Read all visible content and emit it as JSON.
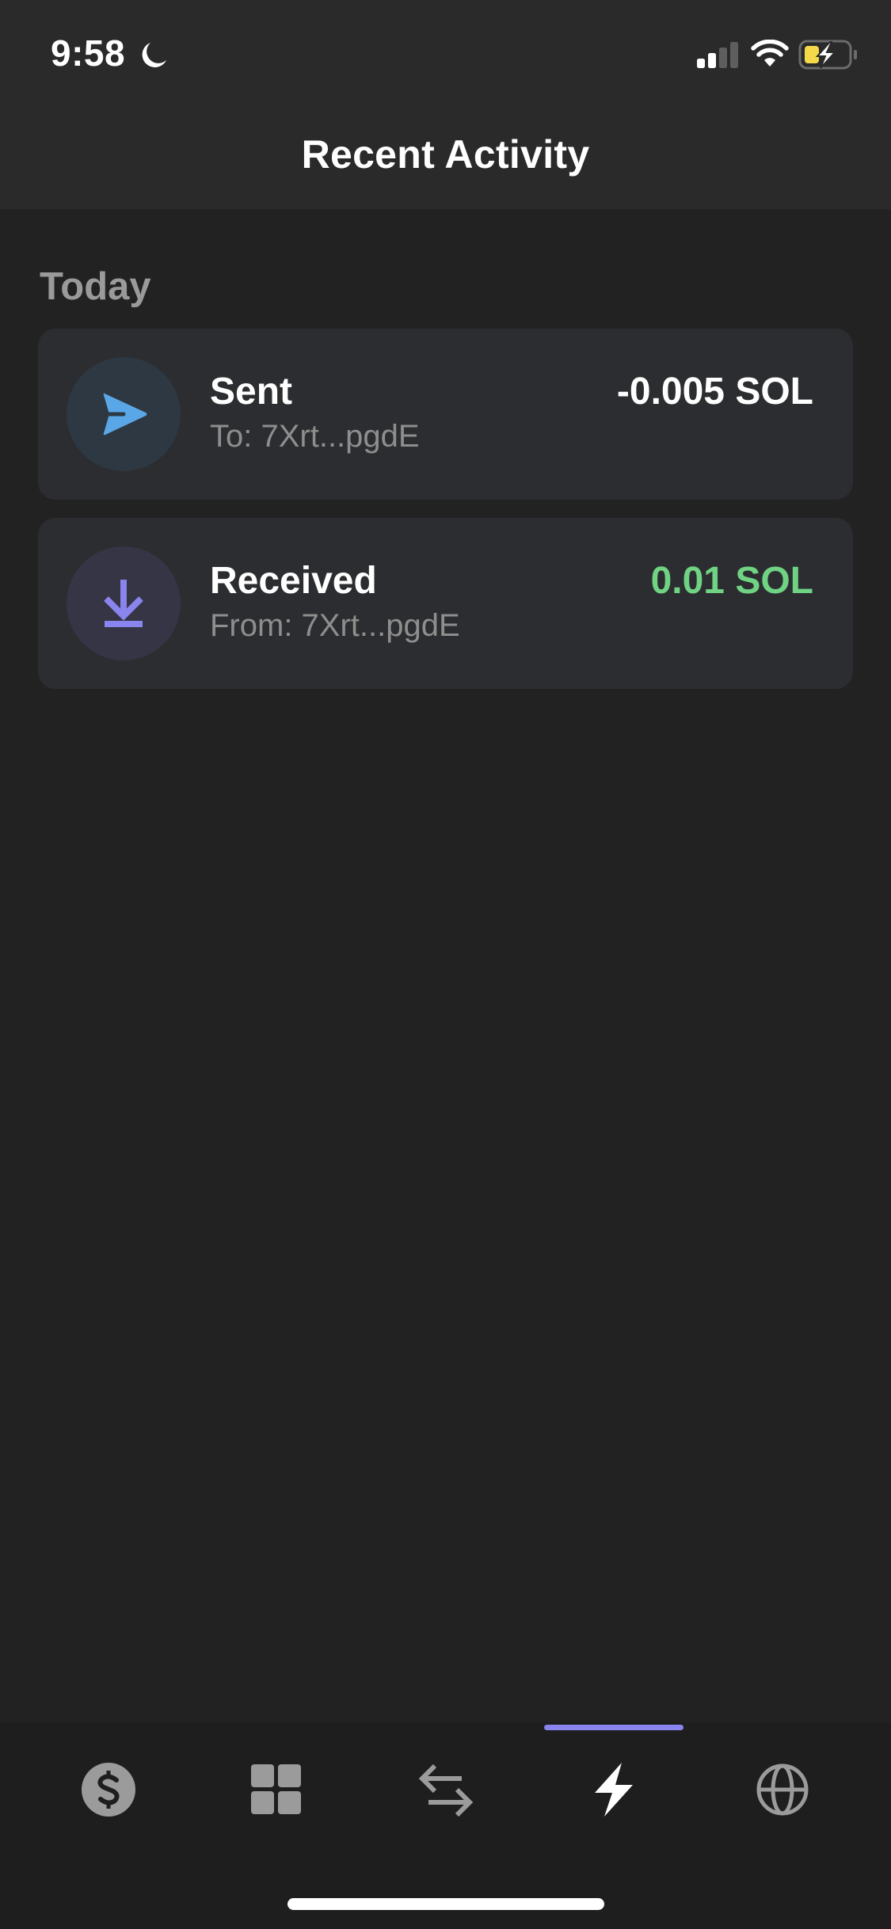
{
  "status_bar": {
    "time": "9:58",
    "focus_mode_icon": "moon-icon",
    "signal_bars_filled": 2,
    "signal_bars_total": 4,
    "wifi_icon": "wifi-icon",
    "battery_icon": "battery-charging-icon",
    "battery_state": "low-power-charging"
  },
  "header": {
    "title": "Recent Activity"
  },
  "sections": [
    {
      "label": "Today",
      "transactions": [
        {
          "type": "Sent",
          "icon": "send-icon",
          "counterparty_label": "To: 7Xrt...pgdE",
          "amount": "-0.005 SOL",
          "amount_color": "#ffffff",
          "icon_color": "#5aa7e8"
        },
        {
          "type": "Received",
          "icon": "download-icon",
          "counterparty_label": "From: 7Xrt...pgdE",
          "amount": "0.01 SOL",
          "amount_color": "#6fd383",
          "icon_color": "#8a84ee"
        }
      ]
    }
  ],
  "tab_bar": {
    "active_index": 3,
    "accent_color": "#8a84ee",
    "tabs": [
      {
        "name": "wallet",
        "icon": "dollar-circle-icon"
      },
      {
        "name": "collectibles",
        "icon": "grid-icon"
      },
      {
        "name": "swap",
        "icon": "swap-arrows-icon"
      },
      {
        "name": "activity",
        "icon": "lightning-icon"
      },
      {
        "name": "browser",
        "icon": "globe-icon"
      }
    ]
  }
}
